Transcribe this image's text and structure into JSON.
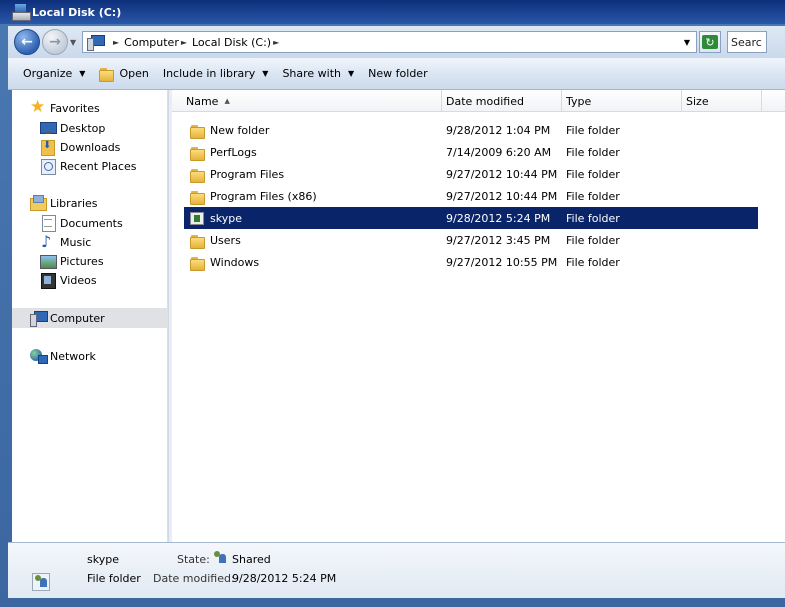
{
  "window": {
    "title": "Local Disk (C:)"
  },
  "address": {
    "crumbs": [
      "Computer",
      "Local Disk (C:)"
    ],
    "search_placeholder": "Searc"
  },
  "toolbar": {
    "organize": "Organize",
    "open": "Open",
    "include_in_library": "Include in library",
    "share_with": "Share with",
    "new_folder": "New folder"
  },
  "nav": {
    "favorites": "Favorites",
    "desktop": "Desktop",
    "downloads": "Downloads",
    "recent_places": "Recent Places",
    "libraries": "Libraries",
    "documents": "Documents",
    "music": "Music",
    "pictures": "Pictures",
    "videos": "Videos",
    "computer": "Computer",
    "network": "Network"
  },
  "columns": {
    "name": "Name",
    "date_modified": "Date modified",
    "type": "Type",
    "size": "Size"
  },
  "files": [
    {
      "name": "New folder",
      "date": "9/28/2012 1:04 PM",
      "type": "File folder",
      "icon": "folder-icon"
    },
    {
      "name": "PerfLogs",
      "date": "7/14/2009 6:20 AM",
      "type": "File folder",
      "icon": "folder-icon"
    },
    {
      "name": "Program Files",
      "date": "9/27/2012 10:44 PM",
      "type": "File folder",
      "icon": "folder-icon"
    },
    {
      "name": "Program Files (x86)",
      "date": "9/27/2012 10:44 PM",
      "type": "File folder",
      "icon": "folder-icon"
    },
    {
      "name": "skype",
      "date": "9/28/2012 5:24 PM",
      "type": "File folder",
      "icon": "skype-folder-icon",
      "selected": true
    },
    {
      "name": "Users",
      "date": "9/27/2012 3:45 PM",
      "type": "File folder",
      "icon": "folder-icon"
    },
    {
      "name": "Windows",
      "date": "9/27/2012 10:55 PM",
      "type": "File folder",
      "icon": "folder-icon"
    }
  ],
  "details": {
    "name": "skype",
    "kind": "File folder",
    "state_label": "State:",
    "state_value": "Shared",
    "date_label": "Date modified:",
    "date_value": "9/28/2012 5:24 PM"
  },
  "colors": {
    "selection": "#0a246a",
    "titlebar": "#1e4797"
  }
}
